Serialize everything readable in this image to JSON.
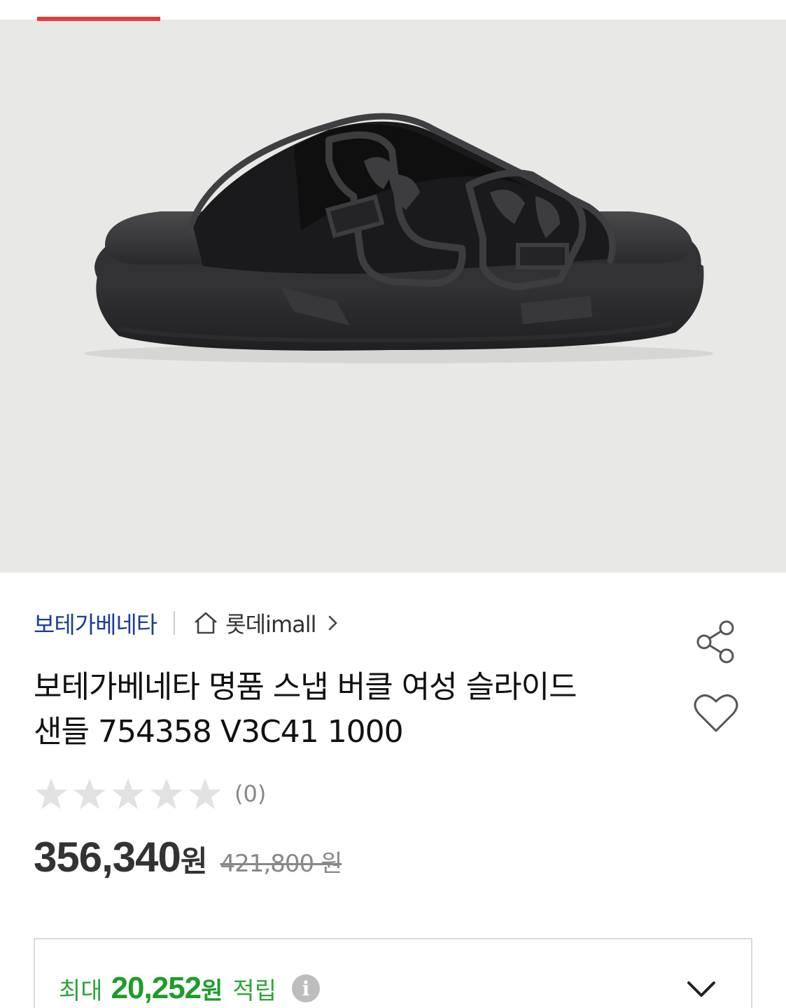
{
  "tabs": {
    "active_indicator_color": "#e63a3a"
  },
  "product": {
    "image_alt_subject": "black slide sandal with snap buckles",
    "brand": "보테가베네타",
    "store": {
      "name": "롯데imall",
      "icon": "home-icon",
      "arrow_icon": "chevron-right-icon"
    },
    "title_line1": "보테가베네타 명품 스냅 버클 여성 슬라이드",
    "title_line2": "샌들 754358 V3C41 1000",
    "rating": {
      "stars_filled": 0,
      "stars_total": 5,
      "review_count": "(0)"
    },
    "price": {
      "amount": "356,340",
      "currency": "원",
      "original": "421,800 원"
    }
  },
  "actions": {
    "share_icon": "share-icon",
    "like_icon": "heart-icon"
  },
  "points": {
    "label": "최대",
    "amount": "20,252",
    "currency": "원",
    "suffix": "적립",
    "info_icon": "info-icon",
    "info_glyph": "i",
    "expand_icon": "chevron-down-icon"
  },
  "colors": {
    "brand_link": "#1b3f95",
    "points_green": "#1d9c2a",
    "accent_red": "#e63a3a",
    "hero_bg": "#e8e8e6"
  }
}
